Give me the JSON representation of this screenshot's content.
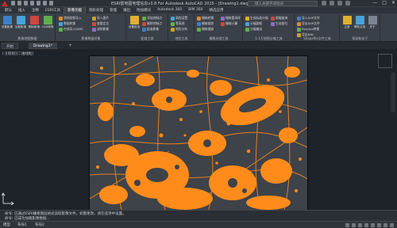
{
  "titlebar": {
    "title": "ESRI暨地图地理信息v3.8 For Autodesk AutoCAD 2015 - [Drawing1.dwg]  Drawing1.dwg",
    "search_placeholder": "键入关键字或短语",
    "window_controls": [
      "—",
      "□",
      "✕"
    ]
  },
  "ribbon_tabs": [
    "默认",
    "插入",
    "注释",
    "ESRI工具",
    "影像功能",
    "图形处理",
    "管理",
    "输出",
    "附加模块",
    "Autodesk 360",
    "BIM 360",
    "精选应用"
  ],
  "active_tab_index": 4,
  "ribbon": {
    "groups": [
      {
        "label": "影像地图数据",
        "buttons": [
          "设置影像",
          "加载影像",
          "删除影像",
          "CAD转换",
          "影像范围"
        ]
      },
      {
        "label": "影像数据对象",
        "buttons": [
          "透视投影导入",
          "数据转换",
          "在线导入WMS",
          "导入图片",
          "查看定位",
          "清除影像"
        ]
      },
      {
        "label": "配准工具",
        "buttons": [
          "设置配准",
          "添加控制点",
          "删除控制点",
          "配准影像"
        ]
      },
      {
        "label": "地形工具",
        "buttons": [
          "高程设置",
          "等高线",
          "地形分析"
        ]
      },
      {
        "label": "栅格处理工具",
        "buttons": [
          "栅格转换",
          "栅格裁剪",
          "栅格镶嵌",
          "栅格重采样",
          "栅格计算"
        ]
      },
      {
        "label": "1:1万地图分幅工具",
        "buttons": [
          "生成标准分幅",
          "分幅图框",
          "分幅输出",
          "图幅查询",
          "生成图号"
        ]
      },
      {
        "label": "Shapefile文件工具",
        "buttons": [
          "导入SHP文件",
          "导出SHP文件",
          "Polyline转换",
          "导出KML"
        ]
      },
      {
        "label": "帮助和关于",
        "buttons": [
          "注册",
          "帮助文档",
          "关于"
        ]
      }
    ]
  },
  "doc_tabs": [
    "开始",
    "Drawing1*"
  ],
  "viewport_label": "[-][俯视][二维线框]",
  "command_lines": [
    "命令: 已通过ESRI栅格图层格式读取影像文件，如需更改，请在选项中设置。",
    "命令: 已成功加载影像数据...",
    "键入命令"
  ],
  "status": {
    "layout_tabs": [
      "模型",
      "布局1",
      "布局2"
    ]
  },
  "colors": {
    "background": "#1e2229",
    "accent_orange": "#ff8c1a",
    "ribbon_bg": "#3a4048"
  }
}
